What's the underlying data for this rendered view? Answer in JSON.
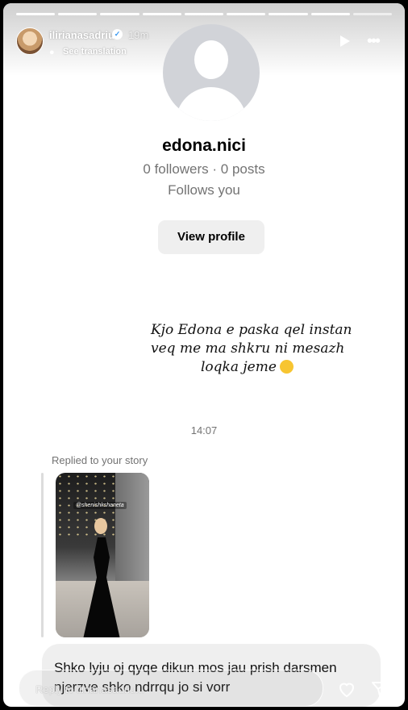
{
  "header": {
    "username": "ilirianasadriu",
    "verified_icon": "verified-badge-icon",
    "time_ago": "19m",
    "see_translation": "See translation",
    "progress_total": 9,
    "progress_done": 8
  },
  "profile": {
    "name": "edona.nici",
    "stats": "0 followers · 0 posts",
    "follows": "Follows you",
    "view_button": "View profile"
  },
  "caption": {
    "line1": "Kjo Edona e paska qel instan",
    "line2": "veq me ma shkru ni mesazh",
    "line3": "loqka jeme"
  },
  "chat": {
    "timestamp": "14:07",
    "replied_label": "Replied to your story",
    "story_tag": "@shenishkshaneta",
    "message": "Shko lyju oj qyqe dikun mos jau prish darsmen njerzve shko ndrrqu jo si vorr"
  },
  "reply_bar": {
    "placeholder": "Reply to ilirianasadriu..."
  },
  "colors": {
    "accent": "#3897f0",
    "bubble": "#efefef",
    "muted_text": "#737373"
  }
}
